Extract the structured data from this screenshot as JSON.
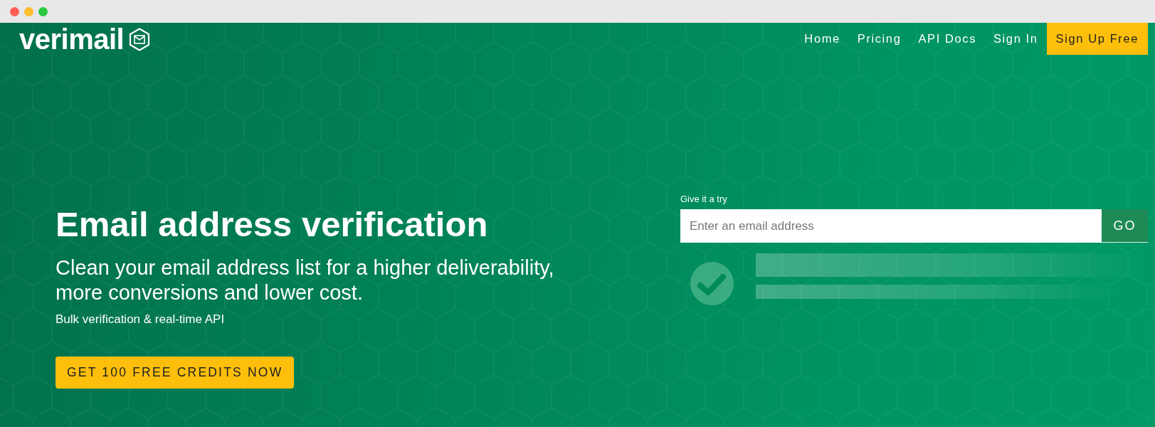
{
  "browser": {
    "window_controls": [
      {
        "color": "#ff5f57"
      },
      {
        "color": "#febc2e"
      },
      {
        "color": "#28c840"
      }
    ]
  },
  "header": {
    "logo": "verimail",
    "nav": [
      {
        "label": "Home",
        "kind": "link"
      },
      {
        "label": "Pricing",
        "kind": "link"
      },
      {
        "label": "API Docs",
        "kind": "link"
      },
      {
        "label": "Sign In",
        "kind": "link"
      },
      {
        "label": "Sign Up Free",
        "kind": "button"
      }
    ]
  },
  "hero": {
    "title": "Email address verification",
    "subtitle": "Clean your email address list for a higher deliverability, more conversions and lower cost.",
    "tagline": "Bulk verification & real-time API",
    "cta": "GET 100 FREE CREDITS NOW"
  },
  "try_form": {
    "label": "Give it a try",
    "placeholder": "Enter an email address",
    "submit": "GO"
  }
}
